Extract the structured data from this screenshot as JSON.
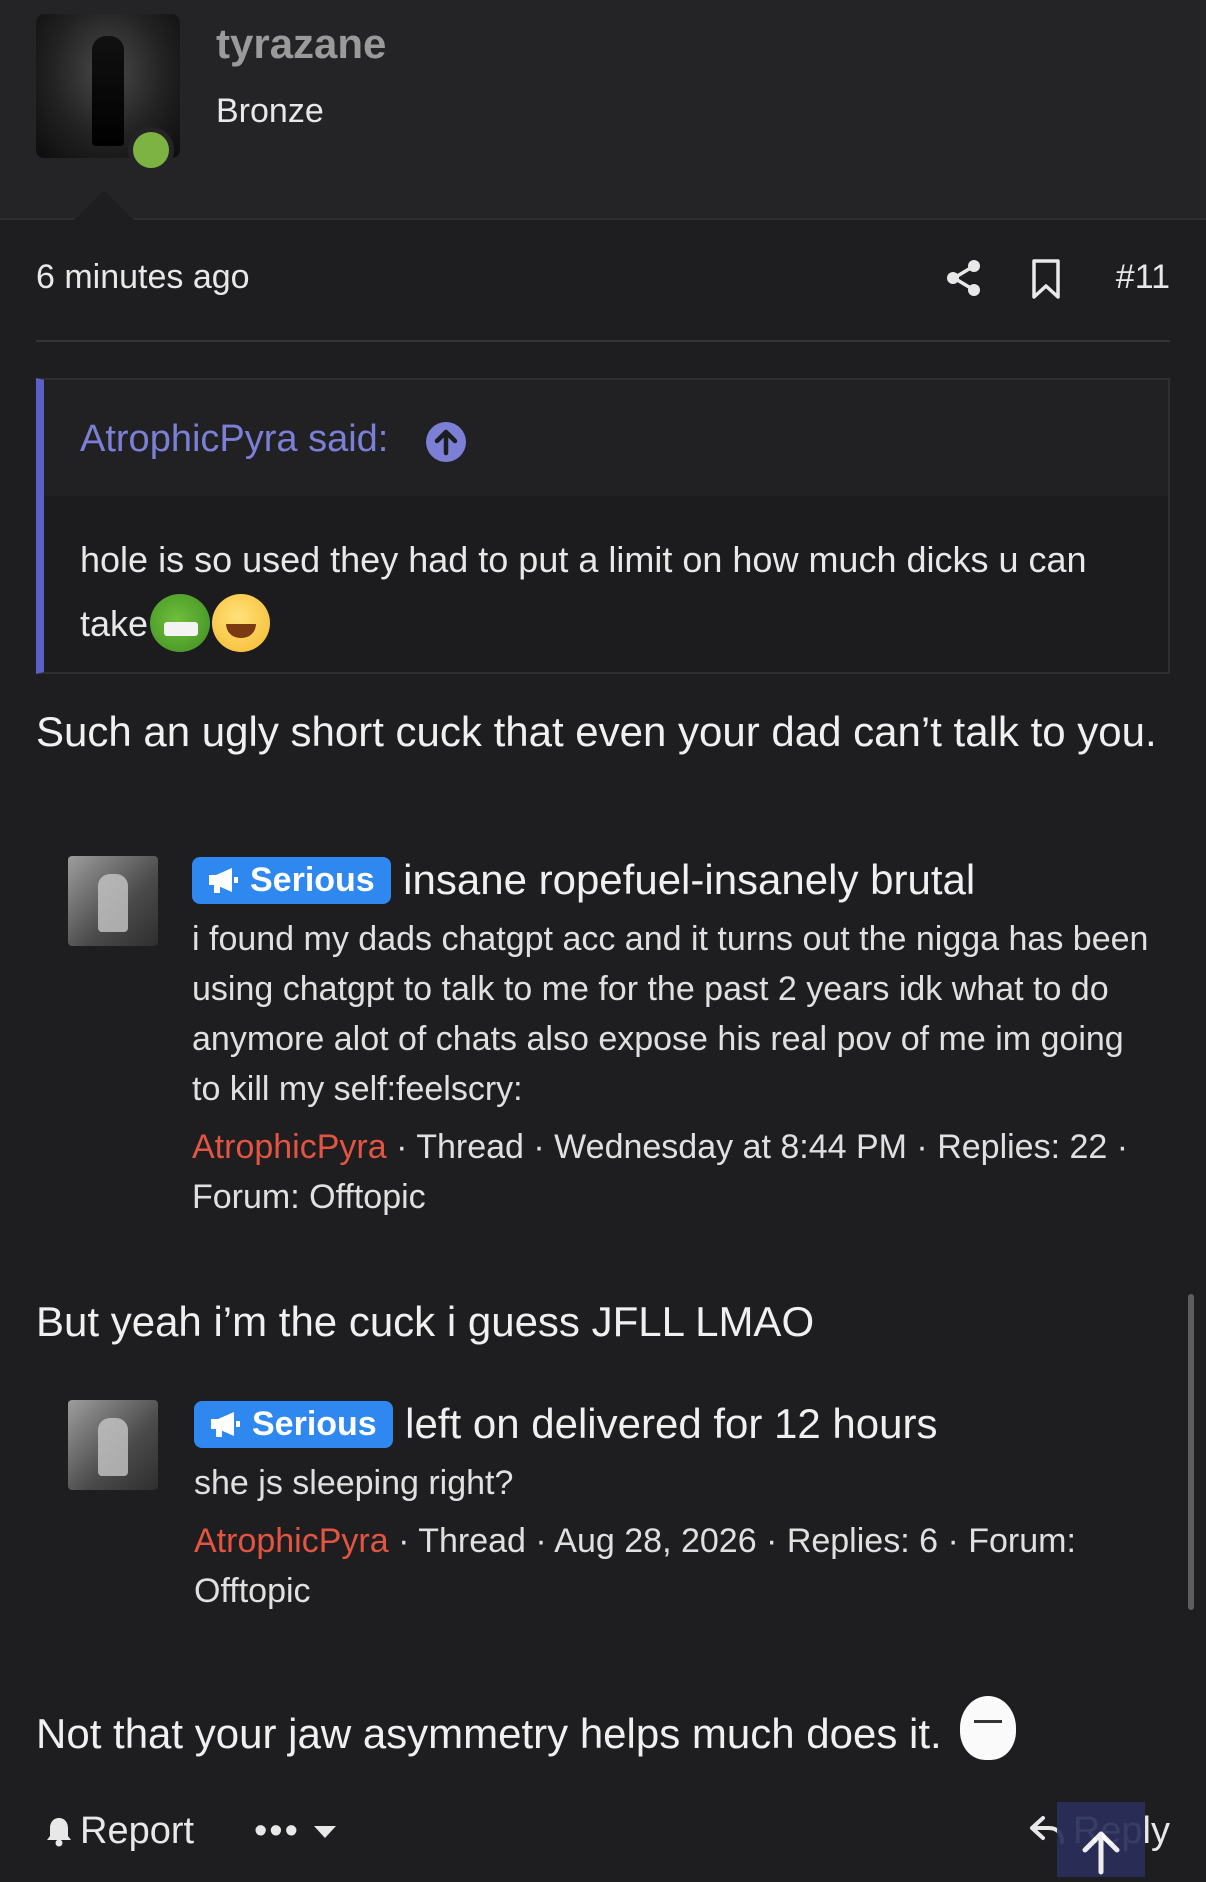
{
  "author": {
    "username": "tyrazane",
    "rank": "Bronze",
    "status_color": "#7cb342"
  },
  "post": {
    "time": "6 minutes ago",
    "number": "#11",
    "quote": {
      "attribution": "AtrophicPyra said:",
      "text": "hole is so used they had to put a limit on how much dicks u can take"
    },
    "para1": "Such an ugly short cuck that even your dad can’t talk to you.",
    "para2": "But yeah i’m the cuck i guess JFLL LMAO",
    "para3": "Not that your jaw asymmetry helps much does it.",
    "embeds": [
      {
        "badge": "Serious",
        "title": "insane ropefuel-insanely brutal",
        "snippet": "i found my dads chatgpt acc and it turns out the nigga has been using chatgpt to talk to me for the past 2 years idk what to do anymore alot of chats also expose his real pov of me im going to kill my self:feelscry:",
        "author": "AtrophicPyra",
        "meta": " · Thread · Wednesday at 8:44 PM · Replies: 22 · Forum: Offtopic"
      },
      {
        "badge": "Serious",
        "title": "left on delivered for 12 hours",
        "snippet": "she js sleeping right?",
        "author": "AtrophicPyra",
        "meta": " · Thread · Aug 28, 2026 · Replies: 6 · Forum: Offtopic"
      }
    ]
  },
  "actions": {
    "report": "Report",
    "more": "•••",
    "reply": "Reply"
  },
  "colors": {
    "accent_quote": "#7b80d6",
    "badge_blue": "#2f87f0",
    "author_red": "#e35442"
  }
}
